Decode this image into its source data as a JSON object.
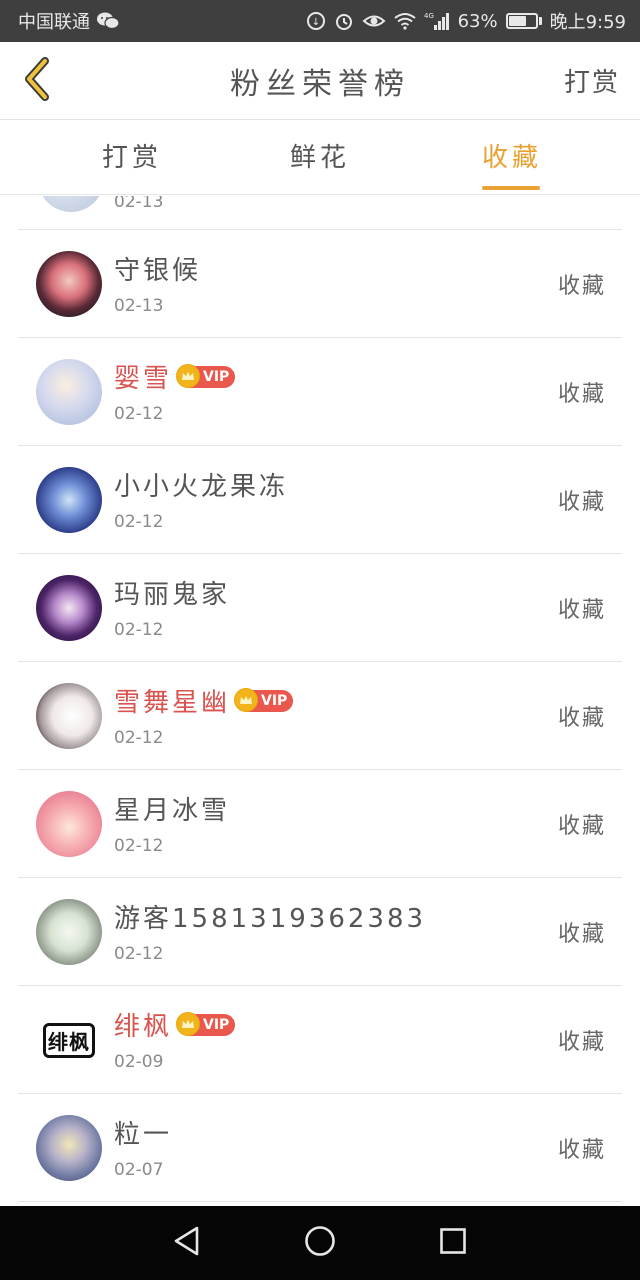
{
  "status_bar": {
    "carrier": "中国联通",
    "network": "4G",
    "battery": "63%",
    "battery_level": 0.63,
    "time": "晚上9:59",
    "icons": [
      "wechat-icon",
      "data-saver-icon",
      "alarm-icon",
      "eye-comfort-icon",
      "wifi-icon",
      "signal-icon",
      "battery-icon"
    ]
  },
  "header": {
    "title": "粉丝荣誉榜",
    "action_label": "打赏",
    "back_icon": "chevron-left-icon"
  },
  "tabs": [
    {
      "label": "打赏",
      "active": false
    },
    {
      "label": "鲜花",
      "active": false
    },
    {
      "label": "收藏",
      "active": true
    }
  ],
  "accent_color": "#e8a233",
  "vip_color": "#e9574d",
  "partial_row": {
    "date": "02-13"
  },
  "fans": [
    {
      "name": "守银候",
      "date": "02-13",
      "action": "收藏",
      "vip": false
    },
    {
      "name": "婴雪",
      "date": "02-12",
      "action": "收藏",
      "vip": true,
      "badge": "VIP"
    },
    {
      "name": "小小火龙果冻",
      "date": "02-12",
      "action": "收藏",
      "vip": false
    },
    {
      "name": "玛丽鬼家",
      "date": "02-12",
      "action": "收藏",
      "vip": false
    },
    {
      "name": "雪舞星幽",
      "date": "02-12",
      "action": "收藏",
      "vip": true,
      "badge": "VIP"
    },
    {
      "name": "星月冰雪",
      "date": "02-12",
      "action": "收藏",
      "vip": false
    },
    {
      "name": "游客1581319362383",
      "date": "02-12",
      "action": "收藏",
      "vip": false
    },
    {
      "name": "绯枫",
      "date": "02-09",
      "action": "收藏",
      "vip": true,
      "badge": "VIP",
      "avatar_text": "绯枫"
    },
    {
      "name": "粒一",
      "date": "02-07",
      "action": "收藏",
      "vip": false
    }
  ],
  "nav_bar": [
    "back-triangle-icon",
    "home-circle-icon",
    "recents-square-icon"
  ]
}
